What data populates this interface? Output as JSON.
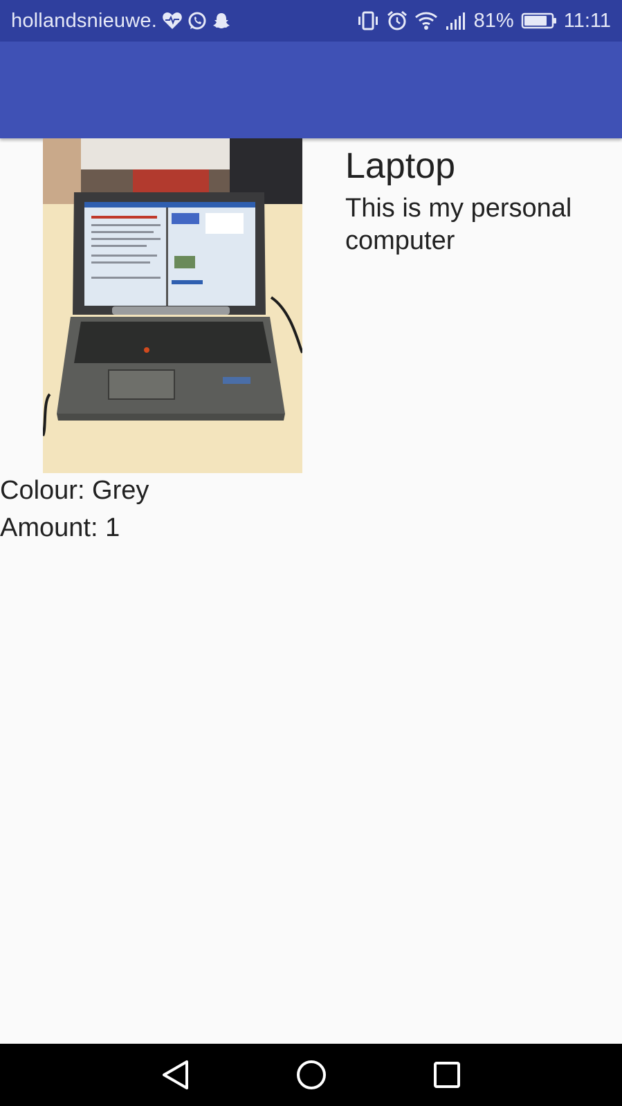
{
  "status_bar": {
    "notification_text": "hollandsnieuwe.",
    "notification_icons": [
      "heart-pulse-icon",
      "whatsapp-icon",
      "snapchat-icon"
    ],
    "system_icons": [
      "vibrate-icon",
      "alarm-icon",
      "wifi-icon",
      "signal-icon",
      "battery-icon"
    ],
    "battery_percent": "81%",
    "time": "11:11",
    "color": "#2f3f9e"
  },
  "app_bar": {
    "color": "#3f51b5"
  },
  "item": {
    "image": "laptop-photo",
    "title": "Laptop",
    "description": "This is my personal computer",
    "colour_text": "Colour: Grey",
    "amount_text": "Amount: 1"
  },
  "nav_bar": {
    "buttons": [
      "back-icon",
      "home-icon",
      "recents-icon"
    ]
  }
}
